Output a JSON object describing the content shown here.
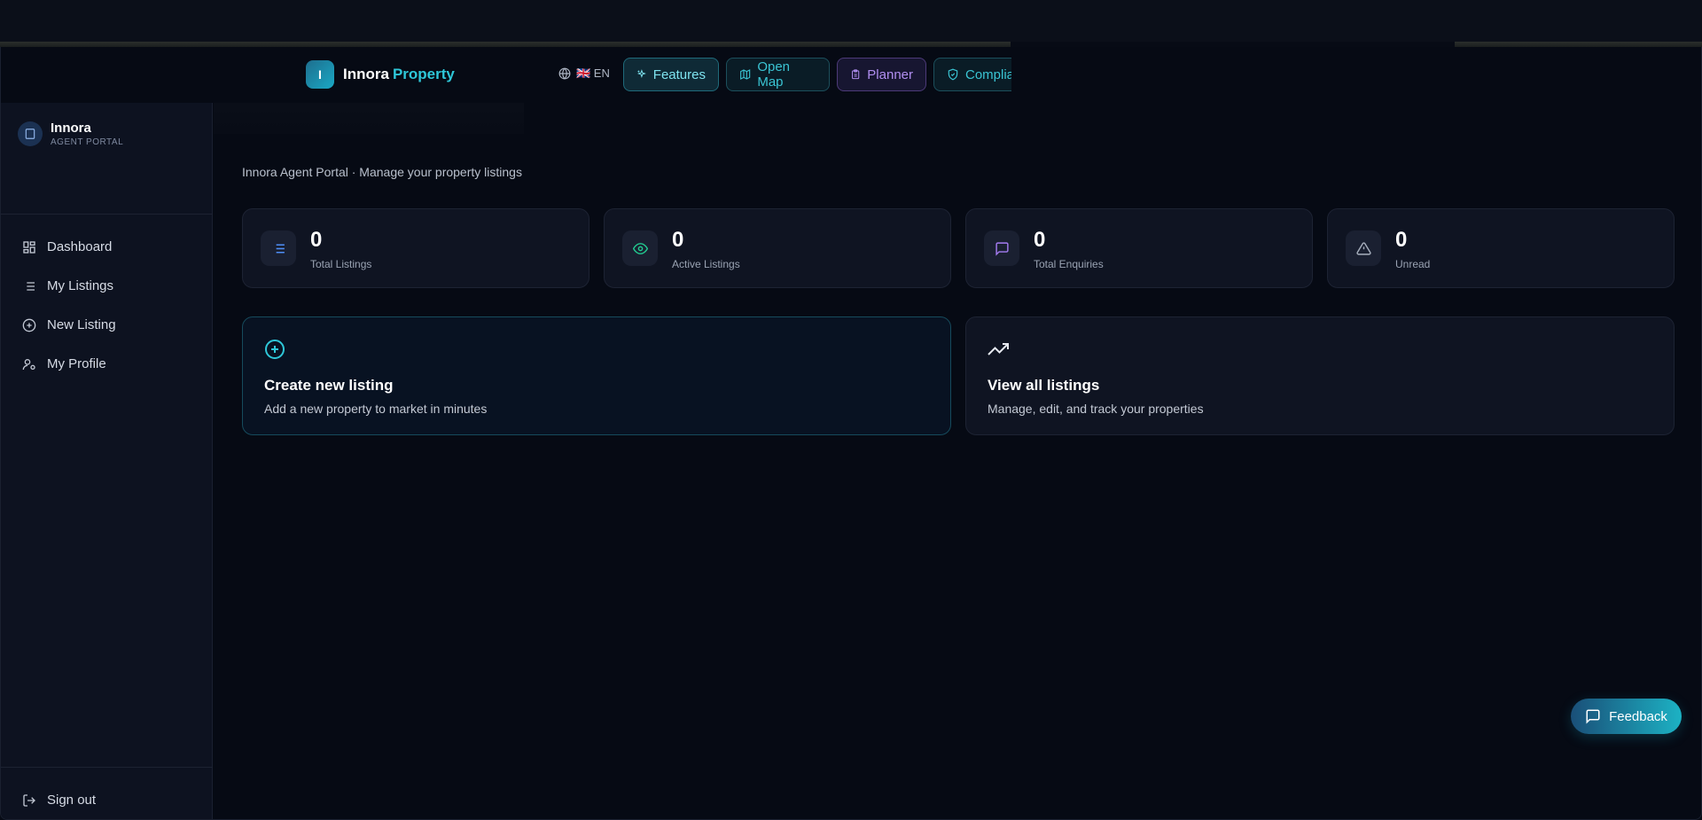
{
  "header": {
    "logo_letter": "I",
    "logo_word1": "Innora",
    "logo_word2": "Property",
    "language": "🇬🇧 EN",
    "nav": {
      "features": "Features",
      "open_map": "Open Map",
      "planner": "Planner",
      "compliance": "Complia"
    }
  },
  "sidebar": {
    "brand_name": "Innora",
    "brand_sub": "AGENT PORTAL",
    "items": [
      {
        "label": "Dashboard",
        "icon": "dashboard-icon"
      },
      {
        "label": "My Listings",
        "icon": "list-icon"
      },
      {
        "label": "New Listing",
        "icon": "plus-circle-icon"
      },
      {
        "label": "My Profile",
        "icon": "user-icon"
      }
    ],
    "sign_out": "Sign out"
  },
  "main": {
    "subtitle": "Innora Agent Portal · Manage your property listings",
    "stats": [
      {
        "value": "0",
        "label": "Total Listings",
        "icon": "list-icon",
        "color": "#4f8ef7"
      },
      {
        "value": "0",
        "label": "Active Listings",
        "icon": "eye-icon",
        "color": "#22c98f"
      },
      {
        "value": "0",
        "label": "Total Enquiries",
        "icon": "message-icon",
        "color": "#a57cf2"
      },
      {
        "value": "0",
        "label": "Unread",
        "icon": "alert-icon",
        "color": "#a7afbd"
      }
    ],
    "actions": [
      {
        "title": "Create new listing",
        "desc": "Add a new property to market in minutes",
        "icon": "plus-circle-icon"
      },
      {
        "title": "View all listings",
        "desc": "Manage, edit, and track your properties",
        "icon": "trending-up-icon"
      }
    ]
  },
  "feedback": {
    "label": "Feedback"
  },
  "colors": {
    "accent": "#2ec7d8",
    "planner": "#b08ef0",
    "background": "#060a14"
  }
}
